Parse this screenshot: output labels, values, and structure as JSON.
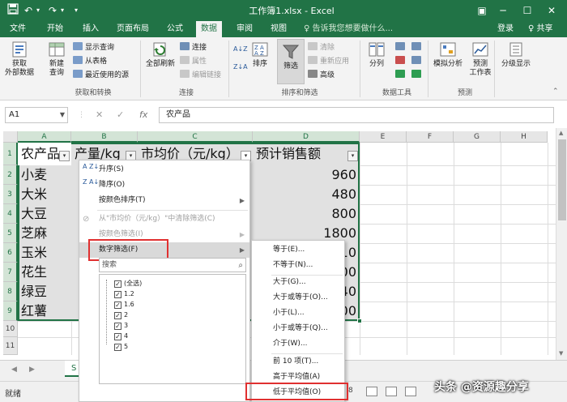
{
  "titlebar": {
    "title": "工作簿1.xlsx - Excel",
    "save_icon": "save-icon",
    "undo_glyph": "↶",
    "redo_glyph": "↷",
    "more_glyph": "▾",
    "min_glyph": "─",
    "max_glyph": "☐",
    "close_glyph": "✕",
    "opts_glyph": "▣"
  },
  "tabs": [
    "文件",
    "开始",
    "插入",
    "页面布局",
    "公式",
    "数据",
    "审阅",
    "视图"
  ],
  "active_tab": "数据",
  "tell_me": "♀ 告诉我您想要做什么...",
  "login": "登录",
  "share": "♀ 共享",
  "ribbon": {
    "get_external": "获取\n外部数据",
    "new_query": "新建\n查询",
    "show_queries": "显示查询",
    "from_table": "从表格",
    "recent_sources": "最近使用的源",
    "group1_label": "获取和转换",
    "refresh_all": "全部刷新",
    "connections": "连接",
    "properties": "属性",
    "edit_links": "编辑链接",
    "group2_label": "连接",
    "sort_az": "A↓Z",
    "sort_za": "Z↓A",
    "sort": "排序",
    "filter": "筛选",
    "clear": "清除",
    "reapply": "重新应用",
    "advanced": "高级",
    "group3_label": "排序和筛选",
    "text_to_columns": "分列",
    "group4_label": "数据工具",
    "what_if": "模拟分析",
    "forecast_sheet": "预测\n工作表",
    "group5_label": "预测",
    "outline": "分级显示"
  },
  "formula_bar": {
    "name_box": "A1",
    "cancel_glyph": "✕",
    "enter_glyph": "✓",
    "fx": "fx",
    "content": "农产品"
  },
  "columns": [
    "A",
    "B",
    "C",
    "D",
    "E",
    "F",
    "G",
    "H"
  ],
  "rows": [
    "1",
    "2",
    "3",
    "4",
    "5",
    "6",
    "7",
    "8",
    "9",
    "10",
    "11"
  ],
  "headers": {
    "a": "农产品",
    "b": "产量/kg",
    "c": "市均价（元/kg）",
    "d": "预计销售额"
  },
  "col_a": [
    "小麦",
    "大米",
    "大豆",
    "芝麻",
    "玉米",
    "花生",
    "绿豆",
    "红薯"
  ],
  "col_d_visible": [
    "960",
    "480",
    "800",
    "1800",
    "10",
    "00",
    "40",
    "00"
  ],
  "filter_glyph": "▾",
  "menu": {
    "sort_asc": "升序(S)",
    "sort_desc": "降序(O)",
    "sort_color": "按颜色排序(T)",
    "clear_filter": "从\"市均价（元/kg）\"中清除筛选(C)",
    "filter_color": "按颜色筛选(I)",
    "number_filters": "数字筛选(F)",
    "search_placeholder": "搜索",
    "search_icon_glyph": "⌕",
    "items": [
      "(全选)",
      "1.2",
      "1.6",
      "2",
      "3",
      "4",
      "5"
    ],
    "asc_icon": "A\nZ↓",
    "desc_icon": "Z\nA↓",
    "arrow": "▶"
  },
  "submenu": {
    "items": [
      "等于(E)...",
      "不等于(N)...",
      "大于(G)...",
      "大于或等于(O)...",
      "小于(L)...",
      "小于或等于(Q)...",
      "介于(W)...",
      "前 10 项(T)...",
      "高于平均值(A)",
      "低于平均值(O)"
    ]
  },
  "sheet_tab": "S",
  "status": {
    "ready": "就绪",
    "count_fragment": "8"
  },
  "watermark": "头条 @资源趣分享",
  "colors": {
    "accent": "#217346",
    "highlight_box": "#e03030"
  }
}
